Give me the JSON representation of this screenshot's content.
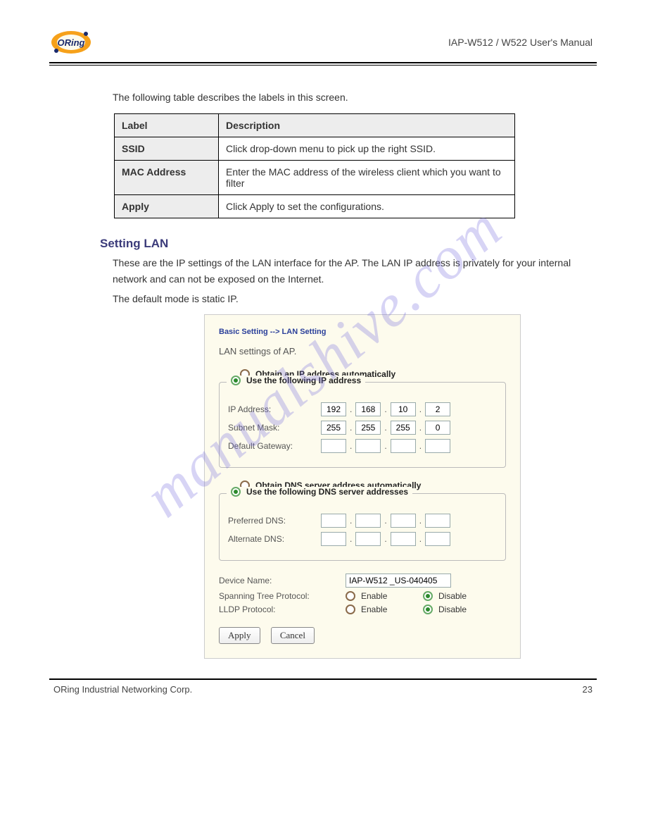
{
  "header": {
    "right": "IAP-W512 / W522  User's Manual"
  },
  "intro": "The following table describes the labels in this screen.",
  "table": {
    "head": {
      "label": "Label",
      "desc": "Description"
    },
    "rows": [
      {
        "label": "SSID",
        "desc": "Click drop-down menu to pick up the right SSID."
      },
      {
        "label": "MAC Address",
        "desc": "Enter the MAC address of the wireless client which you want to filter"
      },
      {
        "label": "Apply",
        "desc": "Click Apply to set the configurations."
      }
    ]
  },
  "section": {
    "title": "Setting LAN",
    "p1": "These are the IP settings of the LAN interface for the AP.  The LAN IP address is privately for your internal network and can not be exposed on the Internet.",
    "p2": "The default mode is static IP."
  },
  "watermark": "manualshive.com",
  "ui": {
    "breadcrumb": "Basic Setting --> LAN Setting",
    "subtitle": "LAN settings of AP.",
    "ip_section": {
      "opt_auto": "Obtain an IP address automatically",
      "opt_manual": "Use the following IP address",
      "selected": "manual",
      "fields": {
        "ip_label": "IP Address:",
        "ip": [
          "192",
          "168",
          "10",
          "2"
        ],
        "mask_label": "Subnet Mask:",
        "mask": [
          "255",
          "255",
          "255",
          "0"
        ],
        "gw_label": "Default Gateway:",
        "gw": [
          "",
          "",
          "",
          ""
        ]
      }
    },
    "dns_section": {
      "opt_auto": "Obtain DNS server address automatically",
      "opt_manual": "Use the following DNS server addresses",
      "selected": "manual",
      "fields": {
        "pdns_label": "Preferred DNS:",
        "pdns": [
          "",
          "",
          "",
          ""
        ],
        "adns_label": "Alternate DNS:",
        "adns": [
          "",
          "",
          "",
          ""
        ]
      }
    },
    "options": {
      "device_name_label": "Device Name:",
      "device_name": "IAP-W512 _US-040405",
      "stp_label": "Spanning Tree Protocol:",
      "lldp_label": "LLDP Protocol:",
      "enable": "Enable",
      "disable": "Disable",
      "stp": "disable",
      "lldp": "disable"
    },
    "buttons": {
      "apply": "Apply",
      "cancel": "Cancel"
    }
  },
  "footer": {
    "left": "ORing Industrial Networking Corp.",
    "right": "23"
  }
}
